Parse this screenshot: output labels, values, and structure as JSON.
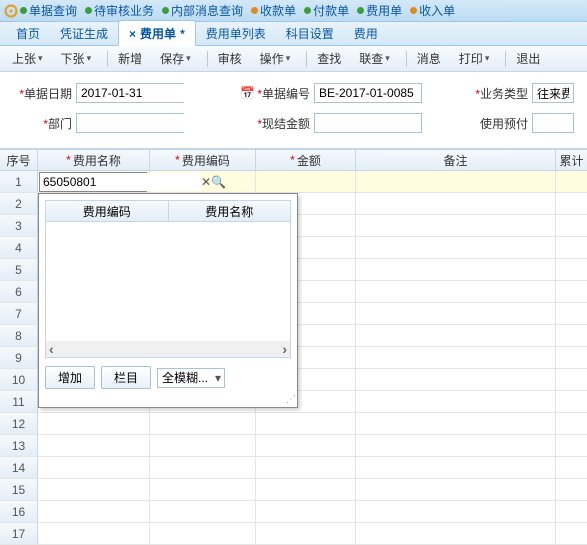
{
  "topmenu": [
    {
      "label": "单据查询",
      "color": "#3b9e3b"
    },
    {
      "label": "待审核业务",
      "color": "#3b9e3b"
    },
    {
      "label": "内部消息查询",
      "color": "#3b9e3b"
    },
    {
      "label": "收款单",
      "color": "#e08b1f"
    },
    {
      "label": "付款单",
      "color": "#3b9e3b"
    },
    {
      "label": "费用单",
      "color": "#3b9e3b"
    },
    {
      "label": "收入单",
      "color": "#e08b1f"
    }
  ],
  "tabs": [
    {
      "label": "首页"
    },
    {
      "label": "凭证生成"
    },
    {
      "label": "费用单",
      "active": true,
      "closable": true
    },
    {
      "label": "费用单列表"
    },
    {
      "label": "科目设置"
    },
    {
      "label": "费用"
    }
  ],
  "toolbar": {
    "prev": "上张",
    "next": "下张",
    "new": "新增",
    "save": "保存",
    "audit": "审核",
    "op": "操作",
    "find": "查找",
    "link": "联查",
    "msg": "消息",
    "print": "打印",
    "exit": "退出"
  },
  "form": {
    "date_lbl": "单据日期",
    "date_val": "2017-01-31",
    "no_lbl": "单据编号",
    "no_val": "BE-2017-01-0085",
    "type_lbl": "业务类型",
    "type_val": "往来费用",
    "dept_lbl": "部门",
    "dept_val": "",
    "cash_lbl": "现结金额",
    "cash_val": "",
    "prepay_lbl": "使用预付",
    "prepay_val": ""
  },
  "grid": {
    "cols": {
      "seq": "序号",
      "name": "费用名称",
      "code": "费用编码",
      "amt": "金额",
      "memo": "备注",
      "sum": "累计"
    },
    "val": "65050801"
  },
  "popup": {
    "c1": "费用编码",
    "c2": "费用名称",
    "add": "增加",
    "col": "栏目",
    "mode": "全模糊..."
  }
}
